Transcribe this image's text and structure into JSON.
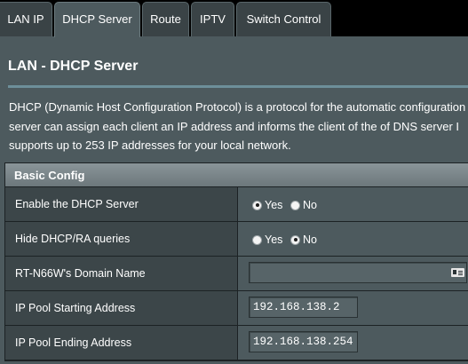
{
  "tabs": [
    {
      "label": "LAN IP",
      "active": false
    },
    {
      "label": "DHCP Server",
      "active": true
    },
    {
      "label": "Route",
      "active": false
    },
    {
      "label": "IPTV",
      "active": false
    },
    {
      "label": "Switch Control",
      "active": false
    }
  ],
  "page": {
    "title": "LAN - DHCP Server",
    "description_lines": [
      "DHCP (Dynamic Host Configuration Protocol) is a protocol for the automatic configuration",
      "server can assign each client an IP address and informs the client of the of DNS server I",
      "supports up to 253 IP addresses for your local network."
    ]
  },
  "basic_config": {
    "header": "Basic Config",
    "enable_dhcp": {
      "label": "Enable the DHCP Server",
      "yes": "Yes",
      "no": "No",
      "selected": "Yes"
    },
    "hide_dhcp": {
      "label": "Hide DHCP/RA queries",
      "yes": "Yes",
      "no": "No",
      "selected": "No"
    },
    "domain_name": {
      "label": "RT-N66W's Domain Name",
      "value": "",
      "icon": "id-card-icon"
    },
    "pool_start": {
      "label": "IP Pool Starting Address",
      "value": "192.168.138.2"
    },
    "pool_end": {
      "label": "IP Pool Ending Address",
      "value": "192.168.138.254"
    }
  },
  "colors": {
    "background": "#4d5a5e",
    "tabbar": "#000000",
    "rule": "#6d8f9a",
    "label_bg": "#3c4649"
  }
}
